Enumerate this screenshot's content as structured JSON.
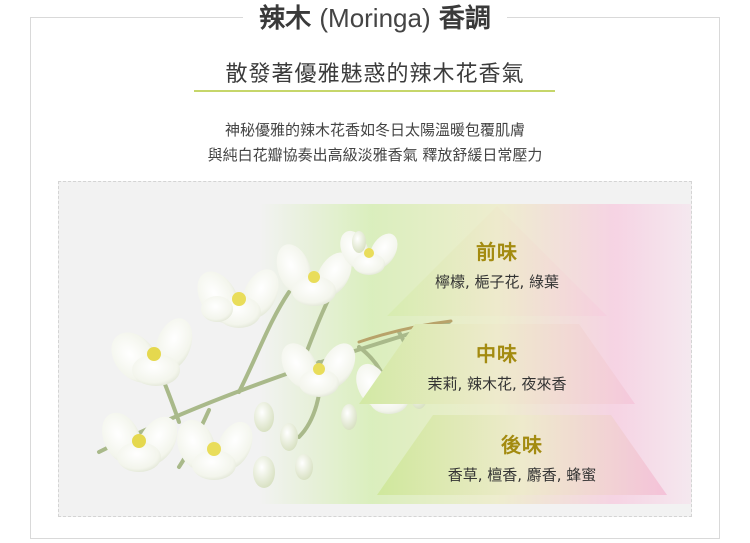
{
  "header": {
    "title_cn": "辣木",
    "title_en": "(Moringa)",
    "title_cn2": "香調"
  },
  "subtitle": "散發著優雅魅惑的辣木花香氣",
  "description": {
    "line1": "神秘優雅的辣木花香如冬日太陽溫暖包覆肌膚",
    "line2": "與純白花瓣協奏出高級淡雅香氣 釋放舒緩日常壓力"
  },
  "pyramid": {
    "top": {
      "name": "前味",
      "notes": "檸檬, 梔子花, 綠葉"
    },
    "middle": {
      "name": "中味",
      "notes": "茉莉, 辣木花, 夜來香"
    },
    "base": {
      "name": "後味",
      "notes": "香草, 檀香, 麝香, 蜂蜜"
    }
  },
  "colors": {
    "accent_gold": "#a38b10",
    "underline_green": "#c6d66a",
    "green_tint": "#cfe89c",
    "pink_tint": "#f4c2d9"
  }
}
